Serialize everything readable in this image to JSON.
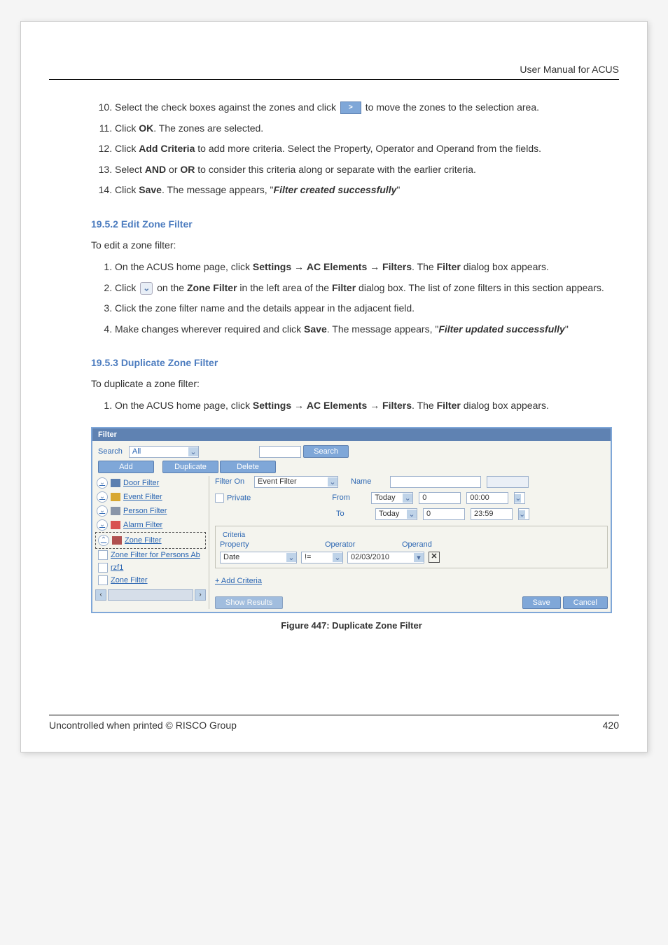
{
  "header": "User Manual for ACUS",
  "step10_a": "Select the check boxes against the zones and click ",
  "step10_b": " to move the zones to the selection area.",
  "step11": "Click <b>OK</b>. The zones are selected.",
  "step12": "Click <b>Add Criteria</b> to add more criteria. Select the Property, Operator and Operand from the fields.",
  "step13": "Select <b>AND</b> or <b>OR</b> to consider this criteria along or separate with the earlier criteria.",
  "step14": "Click <b>Save</b>. The message appears, \"<b><i>Filter created successfully</i></b>\"",
  "sec_19_5_2": {
    "heading": "19.5.2   Edit Zone Filter",
    "intro": "To edit a zone filter:",
    "s1": "On the ACUS home page, click <b>Settings</b> → <b>AC Elements</b> → <b>Filters</b>. The <b>Filter</b> dialog box appears.",
    "s2a": "Click",
    "s2b": " on the <b>Zone Filter</b> in the left area of the <b>Filter</b> dialog box. The list of zone filters in this section appears.",
    "s3": "Click the zone filter name and the details appear in the adjacent field.",
    "s4": "Make changes wherever required and click <b>Save</b>. The message appears, \"<b><i>Filter updated successfully</i></b>\""
  },
  "sec_19_5_3": {
    "heading": "19.5.3   Duplicate Zone Filter",
    "intro": "To duplicate a zone filter:",
    "s1": "On the ACUS home page, click <b>Settings</b> → <b>AC Elements</b> → <b>Filters</b>. The <b>Filter</b> dialog box appears."
  },
  "dlg": {
    "title": "Filter",
    "search_label": "Search",
    "search_value": "All",
    "search_btn": "Search",
    "add": "Add",
    "duplicate": "Duplicate",
    "delete": "Delete",
    "left_items": {
      "door": "Door Filter",
      "event": "Event Filter",
      "person": "Person Filter",
      "alarm": "Alarm Filter",
      "zone": "Zone Filter",
      "sub1": "Zone Filter for Persons Ab",
      "sub2": "rzf1",
      "sub3": "Zone Filter"
    },
    "right": {
      "filter_on": "Filter On",
      "filter_on_val": "Event Filter",
      "name": "Name",
      "name_val": "",
      "private": "Private",
      "from": "From",
      "from_sel": "Today",
      "from_num": "0",
      "from_time": "00:00",
      "to": "To",
      "to_sel": "Today",
      "to_num": "0",
      "to_time": "23:59",
      "criteria": "Criteria",
      "property": "Property",
      "operator": "Operator",
      "operand": "Operand",
      "crit_prop": "Date",
      "crit_op": "!=",
      "crit_val": "02/03/2010",
      "add_crit": "+ Add Criteria",
      "show_results": "Show Results",
      "save": "Save",
      "cancel": "Cancel"
    }
  },
  "figure_caption": "Figure 447: Duplicate Zone Filter",
  "footer_left": "Uncontrolled when printed © RISCO Group",
  "footer_right": "420",
  "chart_data": null
}
